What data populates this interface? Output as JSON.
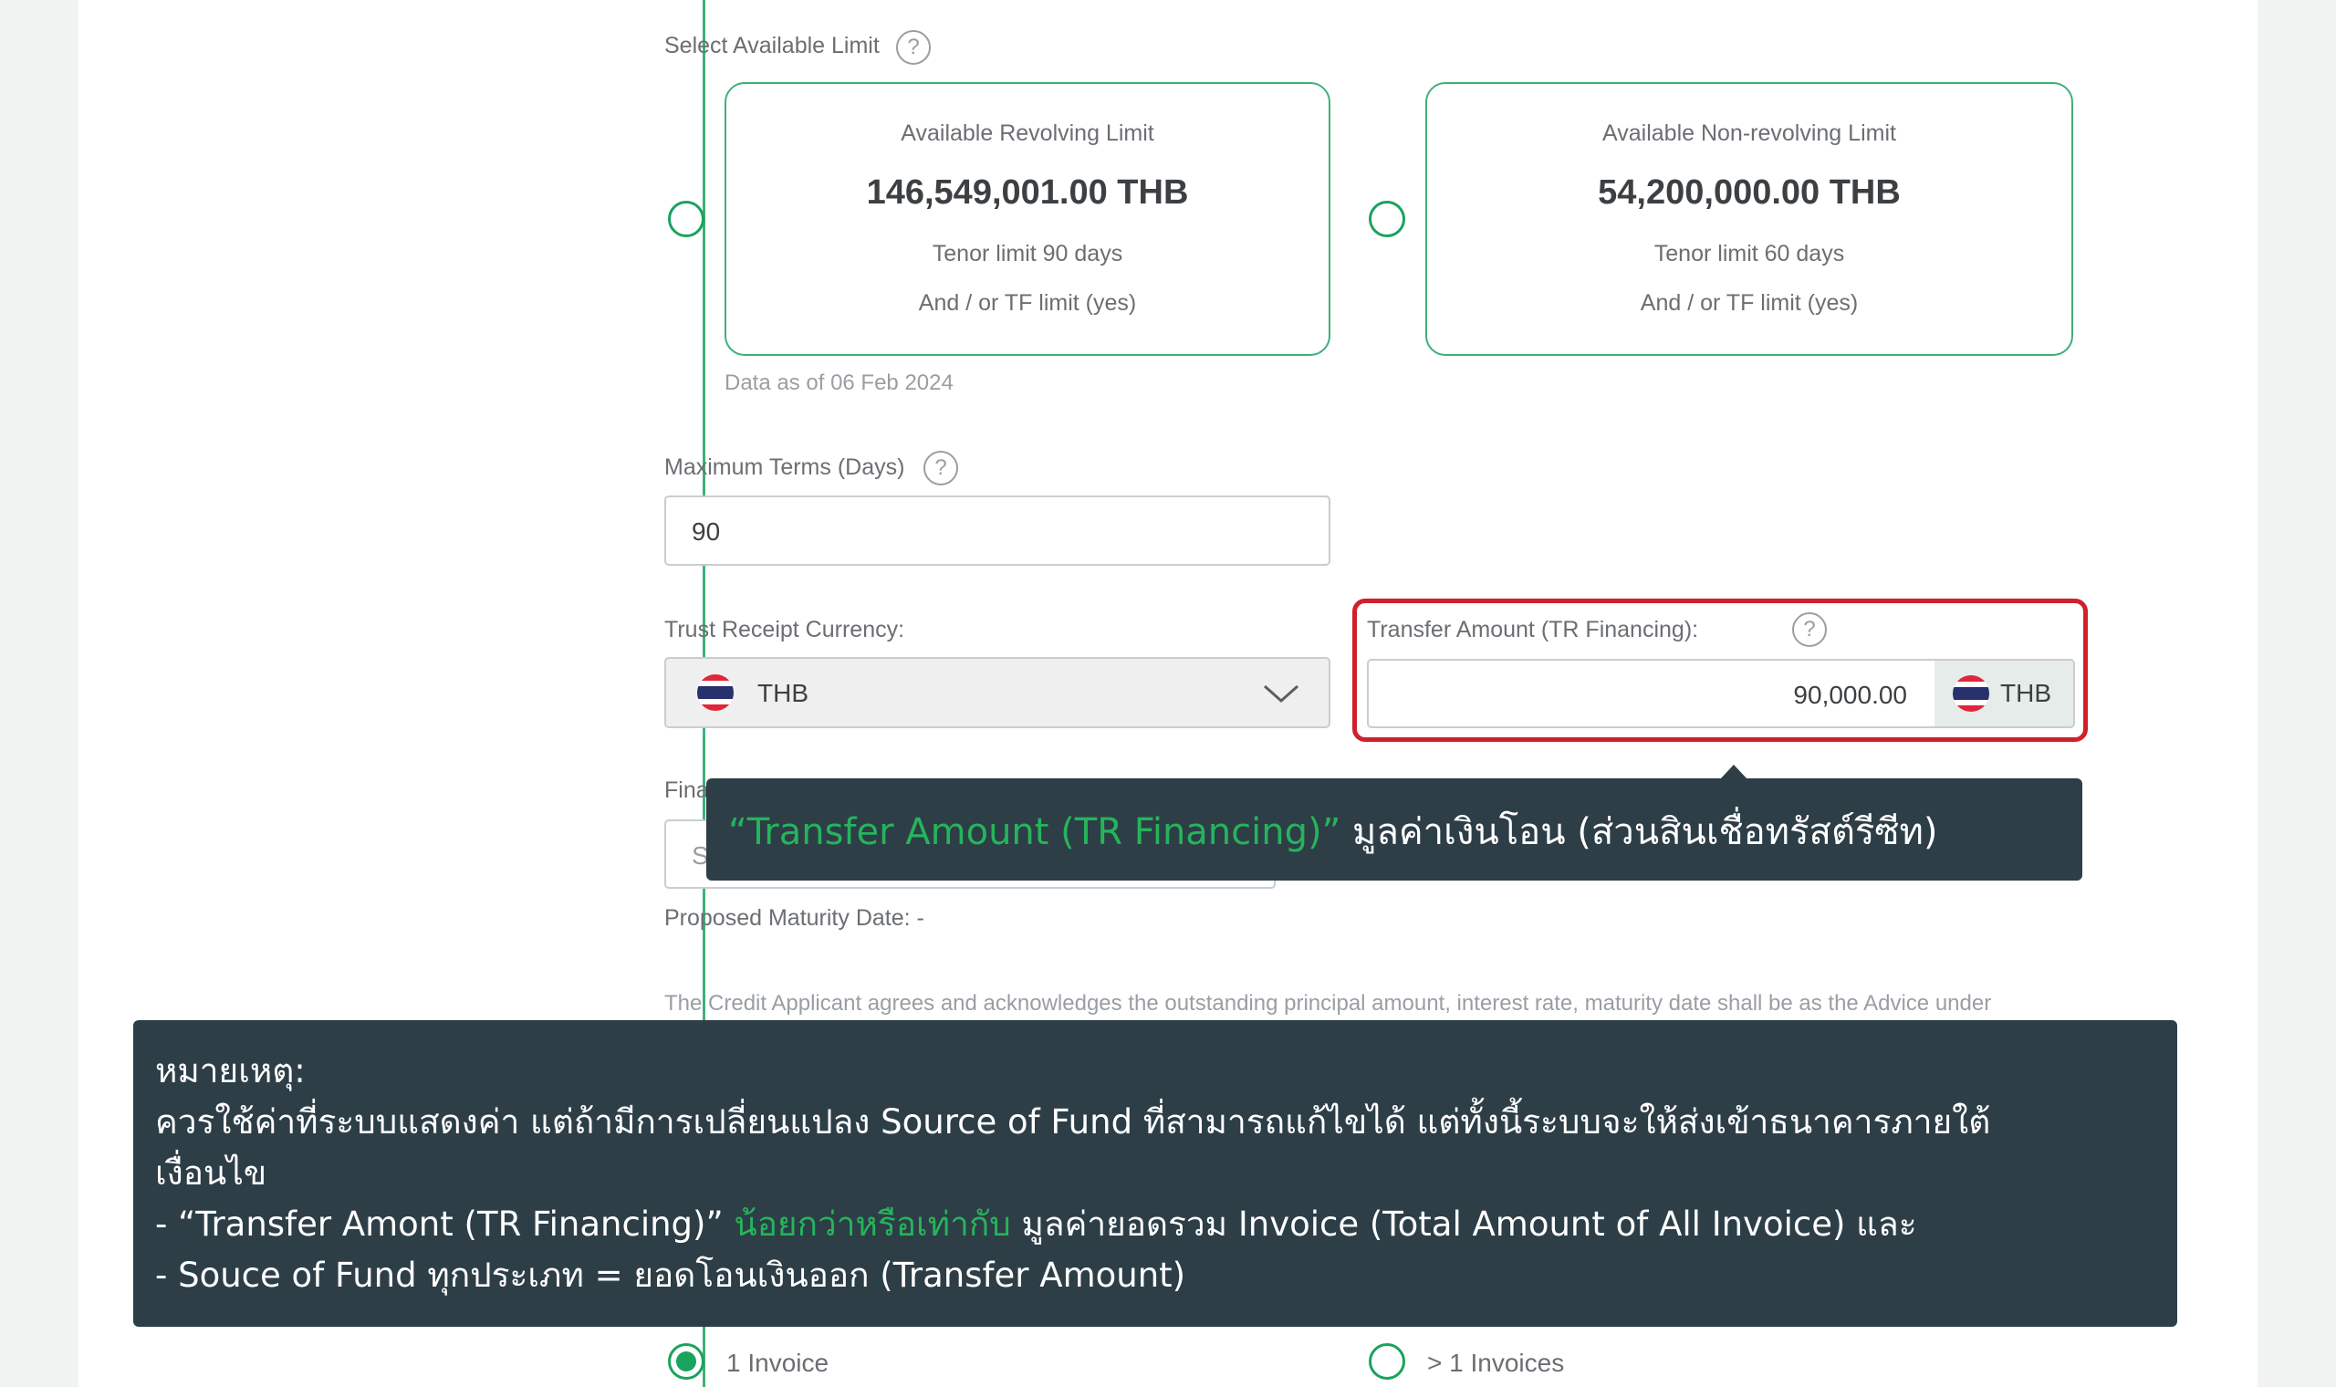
{
  "limits": {
    "section_label": "Select Available Limit",
    "revolving": {
      "title": "Available Revolving Limit",
      "amount": "146,549,001.00 THB",
      "tenor": "Tenor limit 90 days",
      "note": "And / or TF limit (yes)"
    },
    "non_revolving": {
      "title": "Available Non-revolving Limit",
      "amount": "54,200,000.00 THB",
      "tenor": "Tenor limit 60 days",
      "note": "And / or TF limit (yes)"
    },
    "data_as_of": "Data as of 06 Feb 2024"
  },
  "max_terms": {
    "label": "Maximum Terms (Days)",
    "value": "90"
  },
  "currency": {
    "label": "Trust Receipt Currency:",
    "value": "THB"
  },
  "transfer": {
    "label": "Transfer Amount (TR Financing):",
    "value": "90,000.00",
    "currency": "THB"
  },
  "financing": {
    "label_partial": "Fina",
    "value_partial": "S"
  },
  "proposed_maturity": "Proposed Maturity Date: -",
  "agreement_text": "The Credit Applicant agrees and acknowledges the outstanding principal amount, interest rate, maturity date shall be as the Advice under",
  "tooltip": {
    "highlight": "“Transfer Amount (TR Financing)”",
    "text": " มูลค่าเงินโอน (ส่วนสินเชื่อทรัสต์รีซีท)"
  },
  "note": {
    "title": "หมายเหตุ:",
    "line1": "ควรใช้ค่าที่ระบบแสดงค่า แต่ถ้ามีการเปลี่ยนแปลง Source of Fund ที่สามารถแก้ไขได้ แต่ทั้งนี้ระบบจะให้ส่งเข้าธนาคารภายใต้",
    "line2": "เงื่อนไข",
    "line3_start": "- “Transfer Amont (TR Financing)” ",
    "line3_highlight": "น้อยกว่าหรือเท่ากับ",
    "line3_end": " มูลค่ายอดรวม Invoice (Total Amount of All Invoice) และ",
    "line4": "- Souce of Fund ทุกประเภท = ยอดโอนเงินออก (Transfer Amount)"
  },
  "invoice_options": {
    "single": "1 Invoice",
    "multiple": "> 1 Invoices"
  },
  "colors": {
    "accent": "#1aa35d",
    "highlight_border": "#d0202a",
    "tooltip_bg": "#2d3e47"
  }
}
